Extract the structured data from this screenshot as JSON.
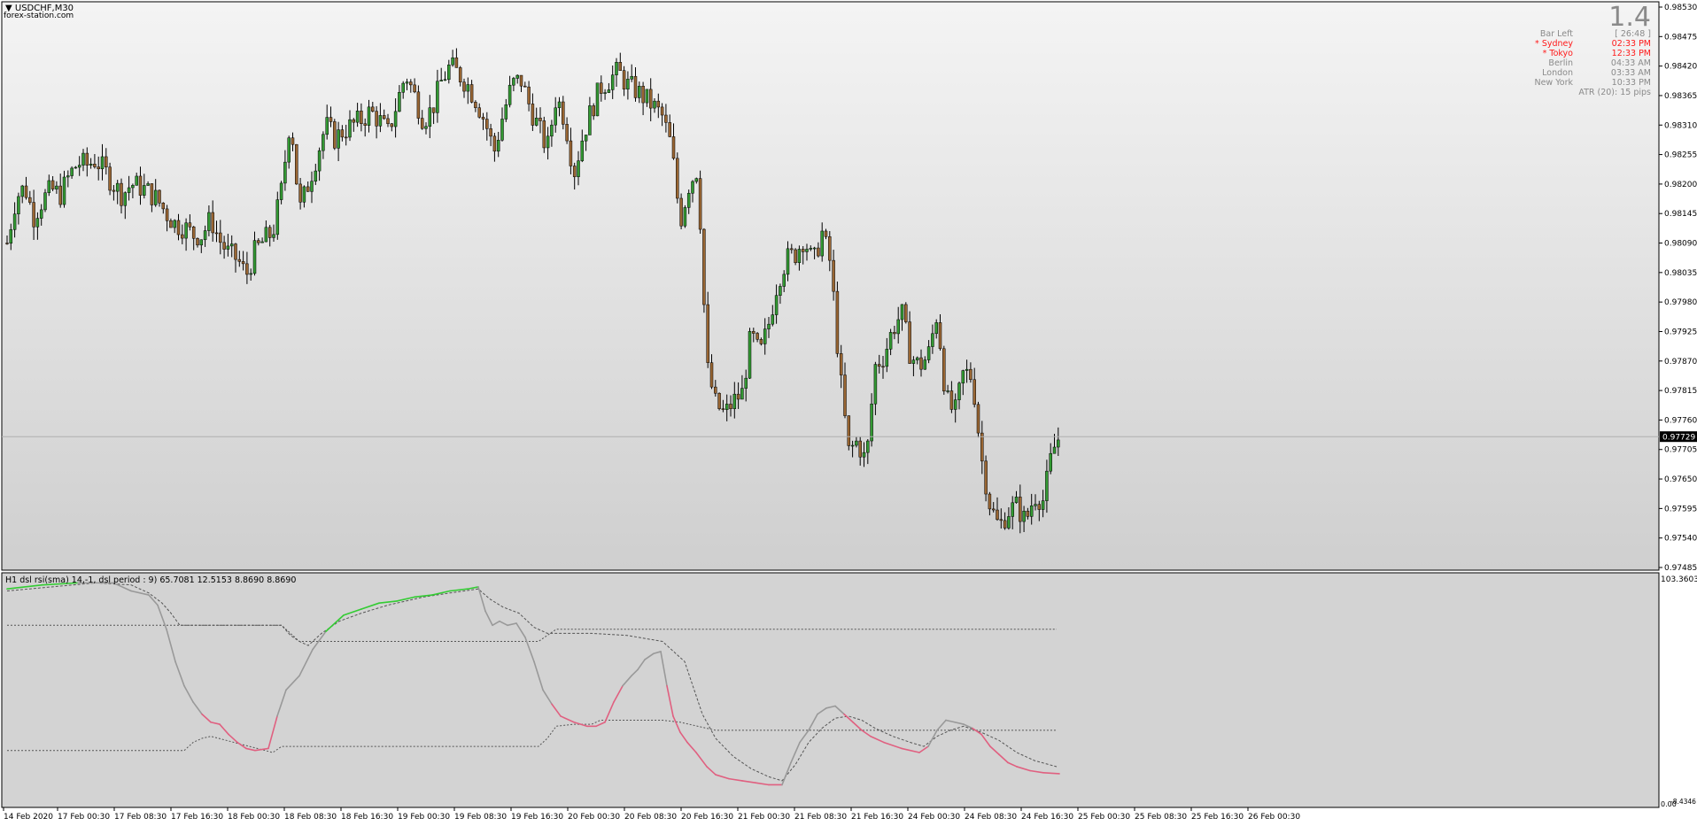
{
  "window": {
    "title": "USDCHF,M30",
    "site": "forex-station.com",
    "big_value": "1.4"
  },
  "session_info": [
    {
      "label": "Bar Left",
      "value": "[ 26:48 ]",
      "color": "#8a8a8a"
    },
    {
      "label": "* Sydney",
      "value": "02:33 PM",
      "color": "#ff1a1a"
    },
    {
      "label": "* Tokyo",
      "value": "12:33 PM",
      "color": "#ff1a1a"
    },
    {
      "label": "Berlin",
      "value": "04:33 AM",
      "color": "#8a8a8a"
    },
    {
      "label": "London",
      "value": "03:33 AM",
      "color": "#8a8a8a"
    },
    {
      "label": "New York",
      "value": "10:33 PM",
      "color": "#8a8a8a"
    }
  ],
  "atr_text": "ATR (20): 15 pips",
  "chart_data": [
    {
      "type": "candlestick",
      "symbol": "USDCHF",
      "timeframe": "M30",
      "y_ticks": [
        "0.98530",
        "0.98475",
        "0.98420",
        "0.98365",
        "0.98310",
        "0.98255",
        "0.98200",
        "0.98145",
        "0.98090",
        "0.98035",
        "0.97980",
        "0.97925",
        "0.97870",
        "0.97815",
        "0.97760",
        "0.97705",
        "0.97650",
        "0.97595",
        "0.97540",
        "0.97485"
      ],
      "ylim": [
        0.97485,
        0.9853
      ],
      "current_price": "0.97729",
      "current_price_value": 0.97729,
      "up_color": "#339933",
      "down_color": "#996633",
      "close_path": [
        [
          0,
          0.9809
        ],
        [
          10,
          0.98175
        ],
        [
          20,
          0.98195
        ],
        [
          30,
          0.9814
        ],
        [
          40,
          0.9817
        ],
        [
          50,
          0.9819
        ],
        [
          60,
          0.9818
        ],
        [
          70,
          0.98215
        ],
        [
          80,
          0.9824
        ],
        [
          90,
          0.98235
        ],
        [
          100,
          0.98245
        ],
        [
          110,
          0.98225
        ],
        [
          120,
          0.982
        ],
        [
          130,
          0.9818
        ],
        [
          140,
          0.982
        ],
        [
          150,
          0.98195
        ],
        [
          160,
          0.98185
        ],
        [
          170,
          0.9817
        ],
        [
          180,
          0.98145
        ],
        [
          190,
          0.98125
        ],
        [
          200,
          0.9812
        ],
        [
          210,
          0.98105
        ],
        [
          220,
          0.98105
        ],
        [
          230,
          0.98135
        ],
        [
          240,
          0.98095
        ],
        [
          250,
          0.9807
        ],
        [
          260,
          0.9806
        ],
        [
          270,
          0.9803
        ],
        [
          280,
          0.98075
        ],
        [
          290,
          0.98095
        ],
        [
          300,
          0.9811
        ],
        [
          310,
          0.9819
        ],
        [
          320,
          0.9833
        ],
        [
          330,
          0.9815
        ],
        [
          340,
          0.982
        ],
        [
          350,
          0.98255
        ],
        [
          360,
          0.9831
        ],
        [
          370,
          0.98285
        ],
        [
          380,
          0.983
        ],
        [
          390,
          0.9831
        ],
        [
          400,
          0.9832
        ],
        [
          410,
          0.98335
        ],
        [
          420,
          0.9832
        ],
        [
          430,
          0.98295
        ],
        [
          440,
          0.9835
        ],
        [
          450,
          0.98405
        ],
        [
          460,
          0.98365
        ],
        [
          470,
          0.9832
        ],
        [
          480,
          0.9834
        ],
        [
          490,
          0.9839
        ],
        [
          500,
          0.9842
        ],
        [
          510,
          0.98405
        ],
        [
          520,
          0.98385
        ],
        [
          530,
          0.98355
        ],
        [
          540,
          0.98315
        ],
        [
          550,
          0.9826
        ],
        [
          560,
          0.9833
        ],
        [
          570,
          0.98385
        ],
        [
          580,
          0.98395
        ],
        [
          590,
          0.98345
        ],
        [
          600,
          0.98305
        ],
        [
          610,
          0.98265
        ],
        [
          620,
          0.98365
        ],
        [
          630,
          0.9832
        ],
        [
          640,
          0.9822
        ],
        [
          650,
          0.9829
        ],
        [
          660,
          0.9834
        ],
        [
          670,
          0.9838
        ],
        [
          680,
          0.98395
        ],
        [
          690,
          0.9841
        ],
        [
          700,
          0.98385
        ],
        [
          710,
          0.98375
        ],
        [
          720,
          0.9836
        ],
        [
          730,
          0.98345
        ],
        [
          740,
          0.98325
        ],
        [
          750,
          0.9827
        ],
        [
          760,
          0.9813
        ],
        [
          770,
          0.982
        ],
        [
          780,
          0.9823
        ],
        [
          790,
          0.9786
        ],
        [
          800,
          0.9779
        ],
        [
          810,
          0.9777
        ],
        [
          820,
          0.97795
        ],
        [
          830,
          0.9781
        ],
        [
          840,
          0.9792
        ],
        [
          850,
          0.9788
        ],
        [
          860,
          0.9794
        ],
        [
          870,
          0.9802
        ],
        [
          880,
          0.9806
        ],
        [
          890,
          0.9807
        ],
        [
          900,
          0.981
        ],
        [
          910,
          0.9805
        ],
        [
          920,
          0.9811
        ],
        [
          930,
          0.9805
        ],
        [
          940,
          0.9785
        ],
        [
          950,
          0.977
        ],
        [
          960,
          0.9772
        ],
        [
          970,
          0.9768
        ],
        [
          980,
          0.9786
        ],
        [
          990,
          0.9788
        ],
        [
          1000,
          0.9793
        ],
        [
          1010,
          0.9796
        ],
        [
          1020,
          0.9788
        ],
        [
          1030,
          0.9786
        ],
        [
          1040,
          0.9788
        ],
        [
          1050,
          0.9796
        ],
        [
          1060,
          0.978
        ],
        [
          1070,
          0.9777
        ],
        [
          1080,
          0.9785
        ],
        [
          1090,
          0.9784
        ],
        [
          1100,
          0.9769
        ],
        [
          1110,
          0.976
        ],
        [
          1120,
          0.9756
        ],
        [
          1130,
          0.9759
        ],
        [
          1140,
          0.976
        ],
        [
          1150,
          0.9757
        ],
        [
          1160,
          0.9762
        ],
        [
          1170,
          0.9761
        ],
        [
          1180,
          0.977
        ],
        [
          1188,
          0.97729
        ]
      ]
    },
    {
      "type": "line",
      "indicator_label": "H1 dsl rsi(sma) 14,-1, dsl period : 9) 65.7081 12.5153 8.8690 8.8690",
      "y_top_label": "103.3603",
      "y_bottom_label": "0.00",
      "y_bottom_label2": "-8.4346",
      "ylim": [
        -8.4346,
        103.3603
      ],
      "rsi": [
        [
          0,
          98
        ],
        [
          40,
          100
        ],
        [
          80,
          101
        ],
        [
          120,
          101
        ],
        [
          140,
          97
        ],
        [
          160,
          95
        ],
        [
          170,
          90
        ],
        [
          180,
          78
        ],
        [
          190,
          62
        ],
        [
          200,
          50
        ],
        [
          210,
          42
        ],
        [
          220,
          36
        ],
        [
          230,
          32
        ],
        [
          240,
          31
        ],
        [
          250,
          26
        ],
        [
          260,
          22
        ],
        [
          270,
          19
        ],
        [
          280,
          18
        ],
        [
          295,
          19
        ],
        [
          305,
          35
        ],
        [
          315,
          48
        ],
        [
          330,
          55
        ],
        [
          345,
          68
        ],
        [
          360,
          77
        ],
        [
          380,
          85
        ],
        [
          400,
          88
        ],
        [
          420,
          91
        ],
        [
          440,
          92
        ],
        [
          460,
          94
        ],
        [
          480,
          95
        ],
        [
          500,
          97
        ],
        [
          520,
          98
        ],
        [
          532,
          99
        ],
        [
          540,
          87
        ],
        [
          548,
          80
        ],
        [
          556,
          82
        ],
        [
          565,
          80
        ],
        [
          575,
          81
        ],
        [
          585,
          74
        ],
        [
          595,
          62
        ],
        [
          605,
          48
        ],
        [
          615,
          41
        ],
        [
          625,
          35
        ],
        [
          640,
          32
        ],
        [
          655,
          30
        ],
        [
          665,
          30
        ],
        [
          675,
          32
        ],
        [
          685,
          42
        ],
        [
          695,
          50
        ],
        [
          705,
          55
        ],
        [
          712,
          58
        ],
        [
          720,
          63
        ],
        [
          730,
          66
        ],
        [
          738,
          67
        ],
        [
          745,
          50
        ],
        [
          752,
          35
        ],
        [
          760,
          27
        ],
        [
          768,
          22
        ],
        [
          778,
          17
        ],
        [
          790,
          10
        ],
        [
          800,
          6
        ],
        [
          815,
          4
        ],
        [
          830,
          3
        ],
        [
          845,
          2
        ],
        [
          860,
          1
        ],
        [
          875,
          1
        ],
        [
          885,
          12
        ],
        [
          895,
          22
        ],
        [
          905,
          28
        ],
        [
          915,
          36
        ],
        [
          925,
          39
        ],
        [
          935,
          40
        ],
        [
          945,
          36
        ],
        [
          955,
          32
        ],
        [
          965,
          28
        ],
        [
          975,
          25
        ],
        [
          990,
          22
        ],
        [
          1010,
          19
        ],
        [
          1030,
          17
        ],
        [
          1040,
          20
        ],
        [
          1050,
          28
        ],
        [
          1060,
          33
        ],
        [
          1070,
          32
        ],
        [
          1080,
          31
        ],
        [
          1090,
          29
        ],
        [
          1100,
          26
        ],
        [
          1110,
          20
        ],
        [
          1120,
          16
        ],
        [
          1130,
          12
        ],
        [
          1140,
          10
        ],
        [
          1155,
          8
        ],
        [
          1170,
          7
        ],
        [
          1188,
          6.5
        ]
      ],
      "signal": [
        [
          0,
          97
        ],
        [
          100,
          101
        ],
        [
          140,
          100
        ],
        [
          160,
          96
        ],
        [
          175,
          91
        ],
        [
          185,
          86
        ],
        [
          195,
          80
        ],
        [
          200,
          80
        ],
        [
          240,
          80
        ],
        [
          280,
          80
        ],
        [
          310,
          80
        ],
        [
          320,
          75
        ],
        [
          330,
          72
        ],
        [
          340,
          70
        ],
        [
          355,
          76
        ],
        [
          375,
          82
        ],
        [
          400,
          86
        ],
        [
          430,
          90
        ],
        [
          470,
          94
        ],
        [
          500,
          96
        ],
        [
          532,
          98
        ],
        [
          545,
          93
        ],
        [
          560,
          89
        ],
        [
          578,
          86
        ],
        [
          595,
          79
        ],
        [
          610,
          76
        ],
        [
          625,
          76
        ],
        [
          660,
          76
        ],
        [
          700,
          75
        ],
        [
          740,
          72
        ],
        [
          765,
          62
        ],
        [
          785,
          36
        ],
        [
          800,
          24
        ],
        [
          820,
          15
        ],
        [
          840,
          9
        ],
        [
          860,
          5
        ],
        [
          875,
          3
        ],
        [
          890,
          11
        ],
        [
          905,
          22
        ],
        [
          920,
          29
        ],
        [
          935,
          34
        ],
        [
          950,
          35
        ],
        [
          965,
          33
        ],
        [
          980,
          29
        ],
        [
          1000,
          25
        ],
        [
          1020,
          22
        ],
        [
          1035,
          20
        ],
        [
          1050,
          25
        ],
        [
          1065,
          28
        ],
        [
          1080,
          30
        ],
        [
          1100,
          27
        ],
        [
          1120,
          23
        ],
        [
          1140,
          17
        ],
        [
          1160,
          13
        ],
        [
          1185,
          10
        ]
      ],
      "level_upper": [
        [
          0,
          18
        ],
        [
          200,
          18
        ],
        [
          210,
          22
        ],
        [
          220,
          24
        ],
        [
          230,
          25
        ],
        [
          300,
          17
        ],
        [
          310,
          20
        ],
        [
          320,
          20
        ],
        [
          600,
          20
        ],
        [
          610,
          24
        ],
        [
          620,
          30
        ],
        [
          640,
          31
        ],
        [
          660,
          31
        ],
        [
          670,
          33
        ],
        [
          740,
          33
        ],
        [
          760,
          32
        ],
        [
          800,
          28
        ],
        [
          1185,
          28
        ]
      ],
      "level_top": [
        [
          0,
          80
        ],
        [
          200,
          80
        ],
        [
          310,
          80
        ],
        [
          330,
          72
        ],
        [
          600,
          72
        ],
        [
          620,
          78
        ],
        [
          700,
          78
        ],
        [
          1185,
          78
        ]
      ],
      "up_color": "#33cc33",
      "down_color": "#e06080",
      "neutral_color": "#999999"
    }
  ],
  "x_axis_labels": [
    "14 Feb 2020",
    "17 Feb 00:30",
    "17 Feb 08:30",
    "17 Feb 16:30",
    "18 Feb 00:30",
    "18 Feb 08:30",
    "18 Feb 16:30",
    "19 Feb 00:30",
    "19 Feb 08:30",
    "19 Feb 16:30",
    "20 Feb 00:30",
    "20 Feb 08:30",
    "20 Feb 16:30",
    "21 Feb 00:30",
    "21 Feb 08:30",
    "21 Feb 16:30",
    "24 Feb 00:30",
    "24 Feb 08:30",
    "24 Feb 16:30",
    "25 Feb 00:30",
    "25 Feb 08:30",
    "25 Feb 16:30",
    "26 Feb 00:30"
  ]
}
